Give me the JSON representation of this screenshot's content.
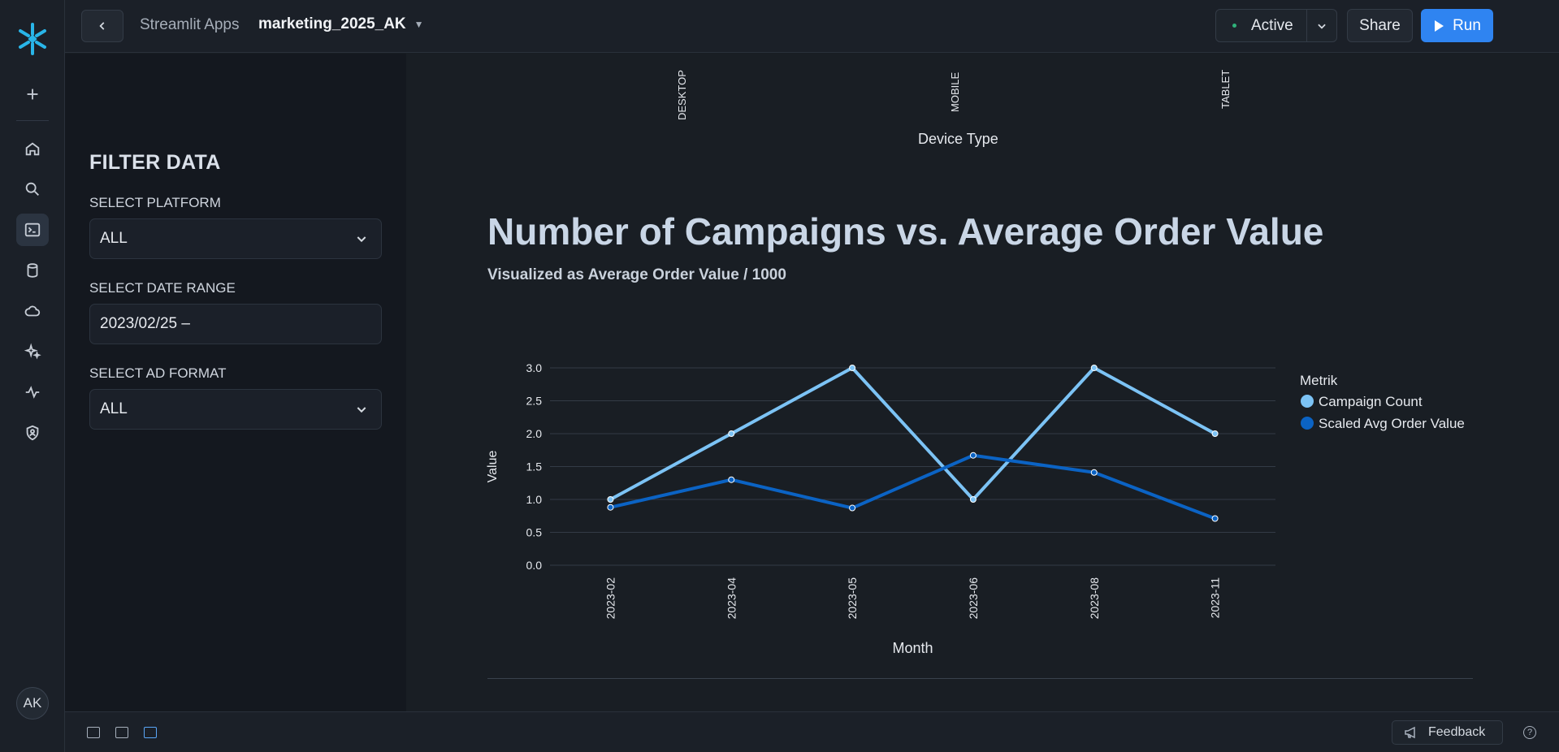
{
  "topbar": {
    "breadcrumb": "Streamlit Apps",
    "app_name": "marketing_2025_AK",
    "status": "Active",
    "share_label": "Share",
    "run_label": "Run"
  },
  "rail": {
    "icons": [
      "snowflake-logo-icon",
      "plus-icon",
      "home-icon",
      "search-icon",
      "projects-icon",
      "database-icon",
      "cloud-icon",
      "sparkle-icon",
      "activity-icon",
      "shield-user-icon"
    ],
    "active": "projects-icon",
    "avatar": "AK"
  },
  "sidebar": {
    "heading": "FILTER DATA",
    "platform_label": "SELECT PLATFORM",
    "platform_value": "ALL",
    "date_label": "SELECT DATE RANGE",
    "date_value": "2023/02/25 –",
    "ad_format_label": "SELECT AD FORMAT",
    "ad_format_value": "ALL"
  },
  "device_chart": {
    "ticks": [
      "DESKTOP",
      "MOBILE",
      "TABLET"
    ],
    "axis_title": "Device Type"
  },
  "main": {
    "heading": "Number of Campaigns vs. Average Order Value",
    "subheading": "Visualized as Average Order Value / 1000"
  },
  "colors": {
    "accent": "#2f84f1",
    "campaign_count": "#7cc3f5",
    "scaled_aov": "#0b63c4"
  },
  "chart_data": {
    "type": "line",
    "categories": [
      "2023-02",
      "2023-04",
      "2023-05",
      "2023-06",
      "2023-08",
      "2023-11"
    ],
    "series": [
      {
        "name": "Campaign Count",
        "values": [
          1.0,
          2.0,
          3.0,
          1.0,
          3.0,
          2.0
        ]
      },
      {
        "name": "Scaled Avg Order Value",
        "values": [
          0.88,
          1.3,
          0.87,
          1.67,
          1.41,
          0.71
        ]
      }
    ],
    "xlabel": "Month",
    "ylabel": "Value",
    "ylim": [
      0,
      3.0
    ],
    "yticks": [
      "3.0",
      "2.5",
      "2.0",
      "1.5",
      "1.0",
      "0.5",
      "0.0"
    ],
    "legend_title": "Metrik",
    "legend_position": "right",
    "grid": true
  },
  "bottombar": {
    "feedback_label": "Feedback",
    "help": "?"
  }
}
